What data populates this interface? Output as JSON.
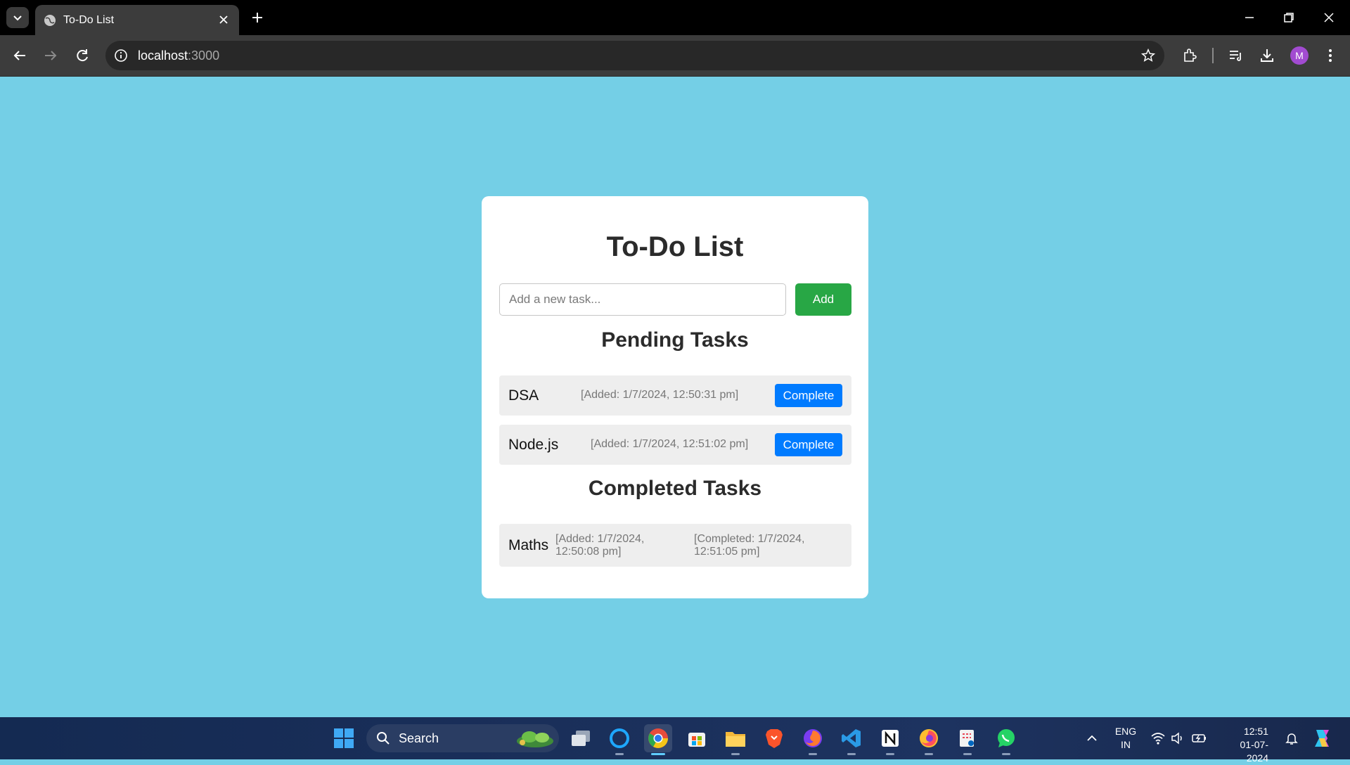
{
  "browser": {
    "tab_title": "To-Do List",
    "url_host": "localhost",
    "url_port": ":3000",
    "profile_initial": "M"
  },
  "page": {
    "title": "To-Do List",
    "input_placeholder": "Add a new task...",
    "add_label": "Add",
    "pending_heading": "Pending Tasks",
    "completed_heading": "Completed Tasks",
    "pending_tasks": [
      {
        "name": "DSA",
        "added": "[Added: 1/7/2024, 12:50:31 pm]",
        "button": "Complete"
      },
      {
        "name": "Node.js",
        "added": "[Added: 1/7/2024, 12:51:02 pm]",
        "button": "Complete"
      }
    ],
    "completed_tasks": [
      {
        "name": "Maths",
        "added_line1": "[Added: 1/7/2024,",
        "added_line2": "12:50:08 pm]",
        "completed_line1": "[Completed: 1/7/2024,",
        "completed_line2": "12:51:05 pm]"
      }
    ]
  },
  "taskbar": {
    "search_label": "Search",
    "lang_line1": "ENG",
    "lang_line2": "IN",
    "time": "12:51",
    "date": "01-07-2024"
  }
}
